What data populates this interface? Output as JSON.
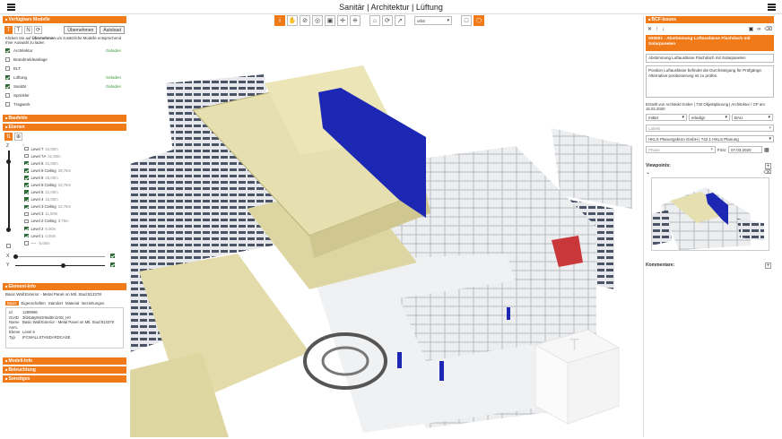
{
  "header": {
    "title": "Sanitär | Architektur | Lüftung"
  },
  "toolbar": {
    "select_value": "orbit"
  },
  "left": {
    "models_title": "Verfügbare Modelle",
    "apply_button": "Übernehmen",
    "autoload_button": "Autoload",
    "hint_prefix": "Klicken Sie auf ",
    "hint_bold": "Übernehmen",
    "hint_suffix": " um zusätzliche Modelle entsprechend Ihrer Auswahl zu laden",
    "models": [
      {
        "name": "Architektur",
        "checked": true,
        "status": "Geladen"
      },
      {
        "name": "Brandmeldeanlage",
        "checked": false,
        "status": ""
      },
      {
        "name": "ELT",
        "checked": false,
        "status": ""
      },
      {
        "name": "Lüftung",
        "checked": true,
        "status": "Geladen"
      },
      {
        "name": "Sanitär",
        "checked": true,
        "status": "Geladen"
      },
      {
        "name": "Sprinkler",
        "checked": false,
        "status": ""
      },
      {
        "name": "Tragwerk",
        "checked": false,
        "status": ""
      }
    ],
    "sections": {
      "buildings": "Baufelde",
      "levels": "Ebenen",
      "element_info": "Element-Info",
      "model_info": "Modell-Info",
      "lighting": "Beleuchtung",
      "misc": "Sonstiges"
    },
    "levels": [
      {
        "name": "Level 7",
        "height": "34,00m",
        "checked": false
      },
      {
        "name": "Level 7A",
        "height": "31,00m",
        "checked": false
      },
      {
        "name": "Level 6",
        "height": "31,00m",
        "checked": true
      },
      {
        "name": "Level 6 Ceiling",
        "height": "28,75m",
        "checked": true
      },
      {
        "name": "Level 6",
        "height": "26,00m",
        "checked": true
      },
      {
        "name": "Level 5 Ceiling",
        "height": "23,75m",
        "checked": true
      },
      {
        "name": "Level 5",
        "height": "21,00m",
        "checked": true
      },
      {
        "name": "Level 4",
        "height": "16,00m",
        "checked": true
      },
      {
        "name": "Level 3 Ceiling",
        "height": "13,75m",
        "checked": true
      },
      {
        "name": "Level 3",
        "height": "11,00m",
        "checked": false
      },
      {
        "name": "Level 2 Ceiling",
        "height": "8,75m",
        "checked": false
      },
      {
        "name": "Level 2",
        "height": "6,00m",
        "checked": true
      },
      {
        "name": "Level 1",
        "height": "0,00m",
        "checked": true
      },
      {
        "name": "----",
        "height": "-5,00m",
        "checked": false
      }
    ],
    "axis_x": "X",
    "axis_y": "Y",
    "z_label": "Z",
    "element_name": "Basic Wall:Exterior - Metal Panel on Mtl. Stud:813378",
    "tabs": [
      "Basis",
      "Eigenschaften",
      "Standort",
      "Material",
      "Beziehungen"
    ],
    "props": [
      {
        "k": "Id",
        "v": "1289996"
      },
      {
        "k": "GUID",
        "v": "3fd4a5y8nDr9sdEn1r0S_H0"
      },
      {
        "k": "Name",
        "v": "Basic Wall:Exterior - Metal Panel on Mtl. Stud:813378"
      },
      {
        "k": "Anm.",
        "v": ""
      },
      {
        "k": "Ebene",
        "v": "Level 6"
      },
      {
        "k": "Typ",
        "v": "IFCWALLSTANDARDCASE"
      }
    ]
  },
  "right": {
    "bcf_title": "BCF-Issues",
    "issue_title": "000001 - Abstimmung Luftauslässe Flachdach mit Solarpanelen",
    "issue_subject": "Abstimmung Luftauslässe Flachdach mit Solarpanelen",
    "issue_description": "Position Luftauslässe befindet die Durchsteigung für Prüfgänge. Alternative positionierung ist zu prüfen.",
    "created": "Erstellt von Architekt GmbH | 730 Objektplanung | Architektur / GP am 16.02.2020",
    "priority": "mittel",
    "status": "erledigt",
    "type": "BAU",
    "labels_placeholder": "Labels",
    "assignee": "HKLS Planungsbüro GmbH | 742.1 HKLS Planung",
    "phase_placeholder": "Phase",
    "deadline_label": "Frist:",
    "deadline": "07.03.2020",
    "viewpoints_label": "Viewpoints:",
    "comments_label": "Kommentare:"
  }
}
